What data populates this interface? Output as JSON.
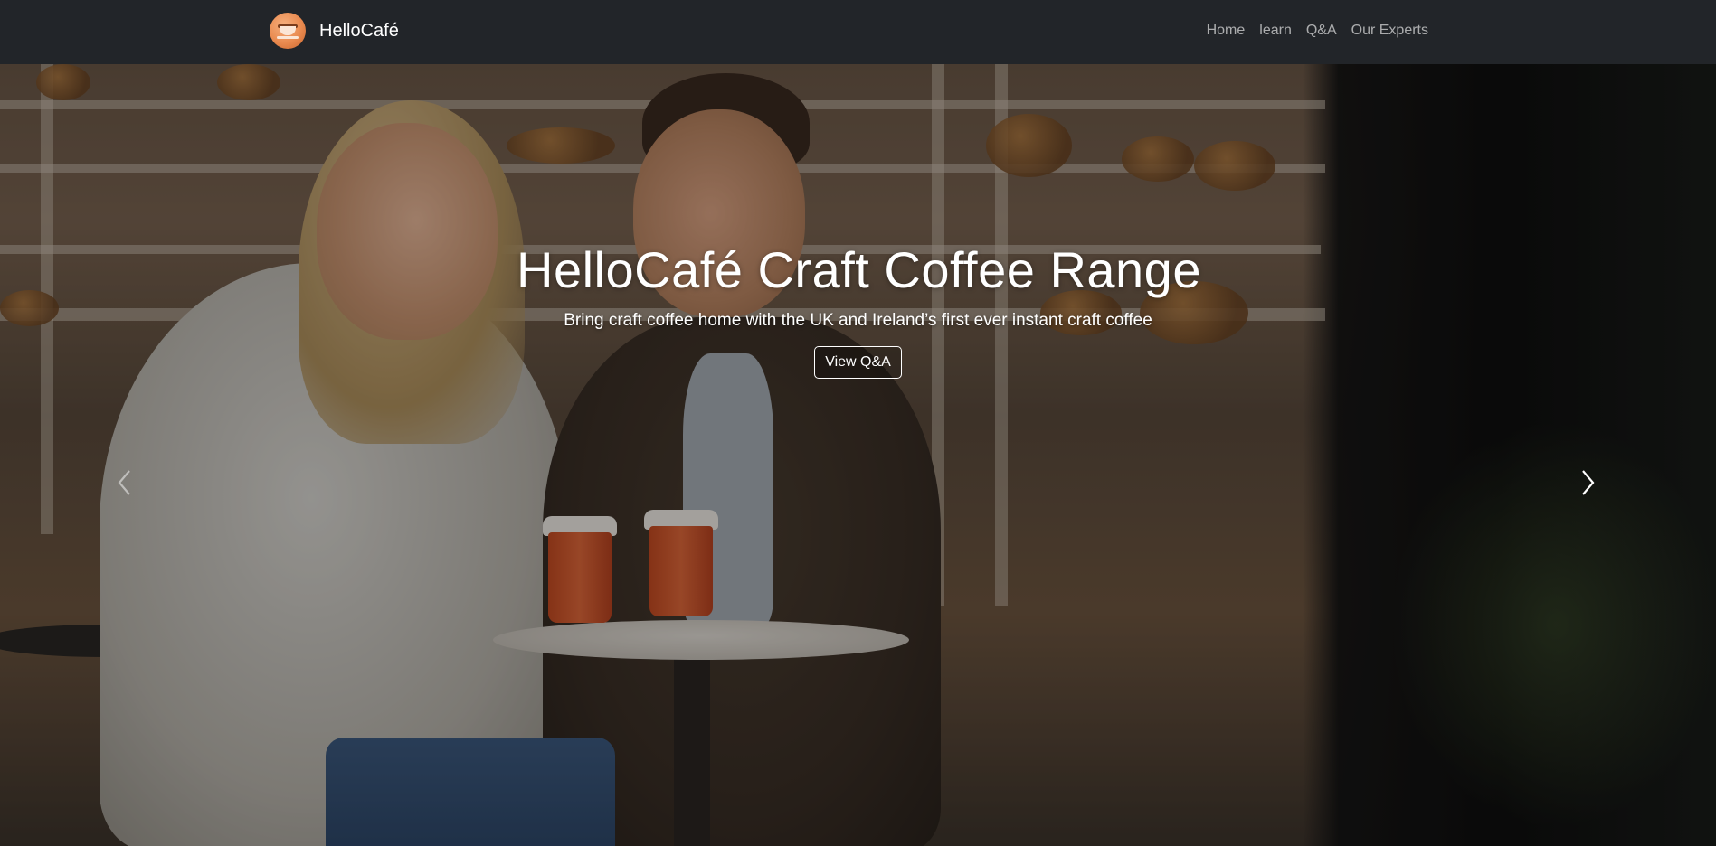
{
  "navbar": {
    "brand_name": "HelloCafé",
    "links": [
      "Home",
      "learn",
      "Q&A",
      "Our Experts"
    ]
  },
  "hero": {
    "title": "HelloCafé Craft Coffee Range",
    "subtitle": "Bring craft coffee home with the UK and Ireland’s first ever instant craft coffee",
    "button_label": "View Q&A",
    "active_slide": 2,
    "slide_count": 3
  },
  "colors": {
    "navbar_bg": "#222529",
    "nav_link": "rgba(255,255,255,0.62)",
    "brand_logo": "#e98a4f"
  },
  "icons": {
    "prev": "chevron-left-icon",
    "next": "chevron-right-icon",
    "logo": "coffee-cup-logo"
  }
}
